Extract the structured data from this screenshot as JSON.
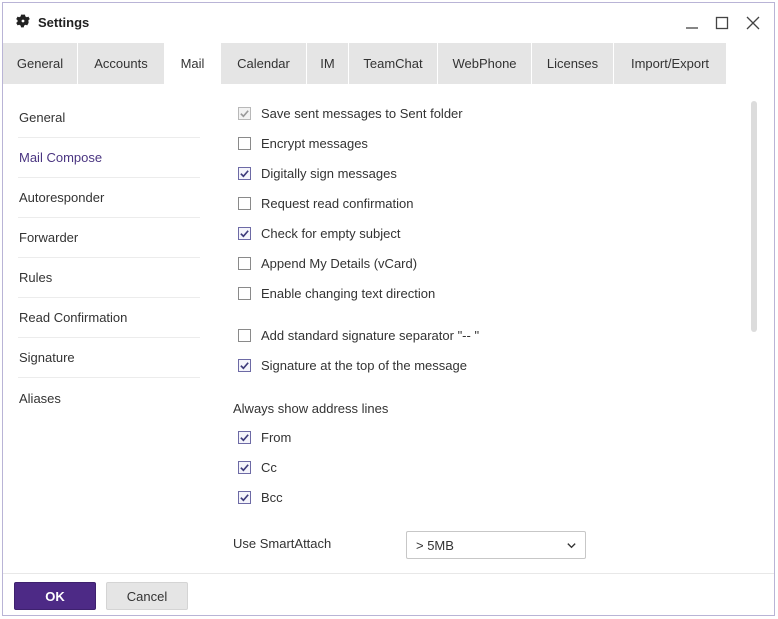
{
  "window": {
    "title": "Settings"
  },
  "tabs": [
    {
      "label": "General"
    },
    {
      "label": "Accounts"
    },
    {
      "label": "Mail",
      "active": true
    },
    {
      "label": "Calendar"
    },
    {
      "label": "IM"
    },
    {
      "label": "TeamChat"
    },
    {
      "label": "WebPhone"
    },
    {
      "label": "Licenses"
    },
    {
      "label": "Import/Export"
    }
  ],
  "sidebar": {
    "items": [
      {
        "label": "General"
      },
      {
        "label": "Mail Compose",
        "active": true
      },
      {
        "label": "Autoresponder"
      },
      {
        "label": "Forwarder"
      },
      {
        "label": "Rules"
      },
      {
        "label": "Read Confirmation"
      },
      {
        "label": "Signature"
      },
      {
        "label": "Aliases"
      }
    ]
  },
  "options": [
    {
      "label": "Save sent messages to Sent folder",
      "checked": true,
      "disabled": true
    },
    {
      "label": "Encrypt messages",
      "checked": false
    },
    {
      "label": "Digitally sign messages",
      "checked": true
    },
    {
      "label": "Request read confirmation",
      "checked": false
    },
    {
      "label": "Check for empty subject",
      "checked": true
    },
    {
      "label": "Append My Details (vCard)",
      "checked": false
    },
    {
      "label": "Enable changing text direction",
      "checked": false
    },
    {
      "label": "Add standard signature separator \"-- \"",
      "checked": false
    },
    {
      "label": "Signature at the top of the message",
      "checked": true
    }
  ],
  "address_lines": {
    "label": "Always show address lines",
    "items": [
      {
        "label": "From",
        "checked": true
      },
      {
        "label": "Cc",
        "checked": true
      },
      {
        "label": "Bcc",
        "checked": true
      }
    ]
  },
  "smart_attach": {
    "label": "Use SmartAttach",
    "value": "> 5MB"
  },
  "footer": {
    "ok_label": "OK",
    "cancel_label": "Cancel"
  },
  "colors": {
    "accent": "#4d2a86",
    "active_link": "#4a3581",
    "tab_bg": "#e5e5e5"
  }
}
